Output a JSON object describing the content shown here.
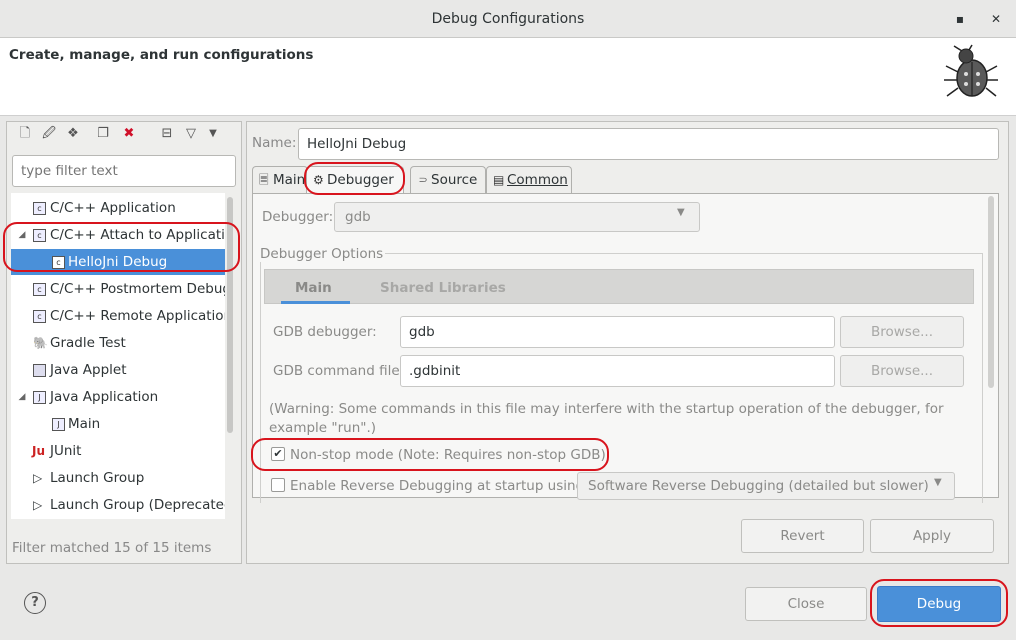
{
  "window": {
    "title": "Debug Configurations",
    "minimize": "▪",
    "maximize": "▫",
    "close": "✕"
  },
  "header": {
    "text": "Create, manage, and run configurations",
    "icon": "bug-icon"
  },
  "left": {
    "filter_placeholder": "type filter text",
    "tree": [
      {
        "label": "C/C++ Application",
        "icon": "c-app-icon"
      },
      {
        "label": "C/C++ Attach to Application",
        "icon": "c-attach-icon",
        "expanded": true
      },
      {
        "label": "HelloJni Debug",
        "icon": "c-attach-icon",
        "selected": true
      },
      {
        "label": "C/C++ Postmortem Debugger",
        "icon": "c-app-icon"
      },
      {
        "label": "C/C++ Remote Application",
        "icon": "c-app-icon"
      },
      {
        "label": "Gradle Test",
        "icon": "gradle-icon"
      },
      {
        "label": "Java Applet",
        "icon": "java-applet-icon"
      },
      {
        "label": "Java Application",
        "icon": "java-app-icon",
        "expanded": true
      },
      {
        "label": "Main",
        "icon": "java-app-icon"
      },
      {
        "label": "JUnit",
        "icon": "junit-icon"
      },
      {
        "label": "Launch Group",
        "icon": "launch-group-icon"
      },
      {
        "label": "Launch Group (Deprecated)",
        "icon": "launch-group-icon"
      }
    ],
    "status": "Filter matched 15 of 15 items"
  },
  "right": {
    "name_label": "Name:",
    "name_value": "HelloJni Debug",
    "tabs": {
      "main": "Main",
      "debugger": "Debugger",
      "source": "Source",
      "common": "Common"
    },
    "debugger_label": "Debugger:",
    "debugger_value": "gdb",
    "options_legend": "Debugger Options",
    "inner_tabs": {
      "main": "Main",
      "shared": "Shared Libraries"
    },
    "gdb_debugger_label": "GDB debugger:",
    "gdb_debugger_value": "gdb",
    "gdb_cmd_label": "GDB command file:",
    "gdb_cmd_value": ".gdbinit",
    "browse": "Browse...",
    "warning": "(Warning: Some commands in this file may interfere with the startup operation of the debugger, for example \"run\".)",
    "nonstop_label": "Non-stop mode (Note: Requires non-stop GDB)",
    "nonstop_checked": true,
    "reverse_label": "Enable Reverse Debugging at startup using:",
    "reverse_checked": false,
    "reverse_value": "Software Reverse Debugging (detailed but slower)",
    "revert": "Revert",
    "apply": "Apply"
  },
  "footer": {
    "help": "?",
    "close": "Close",
    "debug": "Debug"
  },
  "colors": {
    "accent": "#4a90d9",
    "highlight": "#d8141d"
  }
}
